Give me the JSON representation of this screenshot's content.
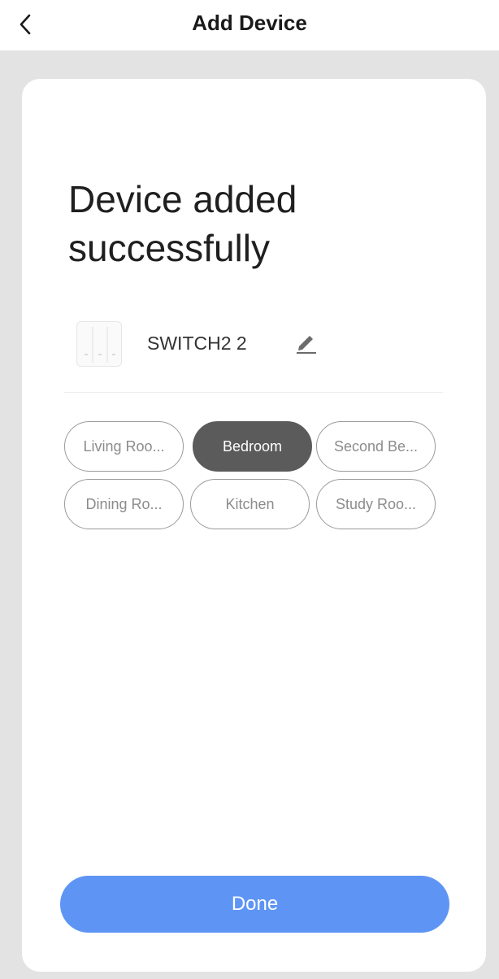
{
  "header": {
    "title": "Add Device",
    "back_icon": "chevron-left-icon"
  },
  "main": {
    "title": "Device added successfully",
    "device": {
      "name": "SWITCH2 2",
      "thumbnail_icon": "switch-device-icon",
      "edit_icon": "pencil-icon"
    },
    "rooms": [
      {
        "label": "Living Roo...",
        "selected": false
      },
      {
        "label": "Bedroom",
        "selected": true
      },
      {
        "label": "Second Be...",
        "selected": false
      },
      {
        "label": "Dining Ro...",
        "selected": false
      },
      {
        "label": "Kitchen",
        "selected": false
      },
      {
        "label": "Study Roo...",
        "selected": false
      }
    ],
    "done_label": "Done"
  },
  "colors": {
    "accent": "#5e95f5",
    "selected_chip": "#5b5b5b",
    "background": "#e3e3e3"
  }
}
